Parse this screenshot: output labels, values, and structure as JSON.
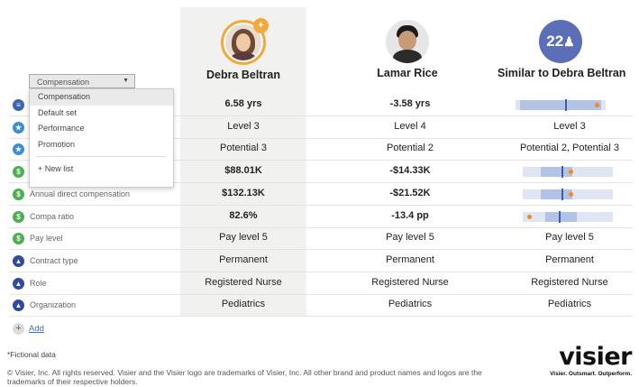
{
  "people": [
    {
      "name": "Debra Beltran",
      "avatar": "photo-woman",
      "pinned": true
    },
    {
      "name": "Lamar Rice",
      "avatar": "photo-man"
    },
    {
      "name": "Similar to Debra Beltran",
      "avatar_text": "22"
    }
  ],
  "dropdown": {
    "selected": "Compensation",
    "items": [
      "Compensation",
      "Default set",
      "Performance",
      "Promotion"
    ],
    "new_list_label": "New list"
  },
  "rows": [
    {
      "icon": "chart-icon",
      "label": "",
      "debra": "6.58 yrs",
      "lamar": "-3.58 yrs",
      "similar_bar": {
        "band": [
          0.05,
          0.95
        ],
        "tick": 0.55,
        "dot": 0.88
      }
    },
    {
      "icon": "star-icon",
      "label": "",
      "debra": "Level 3",
      "lamar": "Level 4",
      "similar": "Level 3"
    },
    {
      "icon": "star-icon",
      "label": "",
      "debra": "Potential 3",
      "lamar": "Potential 2",
      "similar": "Potential 2, Potential 3"
    },
    {
      "icon": "dollar-icon",
      "label": "",
      "debra": "$88.01K",
      "lamar": "-$14.33K",
      "similar_bar": {
        "band": [
          0.2,
          0.55
        ],
        "tick": 0.43,
        "dot": 0.51
      }
    },
    {
      "icon": "dollar-icon",
      "label": "Annual direct compensation",
      "debra": "$132.13K",
      "lamar": "-$21.52K",
      "similar_bar": {
        "band": [
          0.2,
          0.55
        ],
        "tick": 0.43,
        "dot": 0.51
      }
    },
    {
      "icon": "dollar-icon",
      "label": "Compa ratio",
      "debra": "82.6%",
      "lamar": "-13.4 pp",
      "similar_bar": {
        "band": [
          0.25,
          0.6
        ],
        "tick": 0.4,
        "dot": 0.05
      }
    },
    {
      "icon": "dollar-icon",
      "label": "Pay level",
      "debra": "Pay level 5",
      "lamar": "Pay level 5",
      "similar": "Pay level 5"
    },
    {
      "icon": "person-icon",
      "label": "Contract type",
      "debra": "Permanent",
      "lamar": "Permanent",
      "similar": "Permanent"
    },
    {
      "icon": "person-icon",
      "label": "Role",
      "debra": "Registered Nurse",
      "lamar": "Registered Nurse",
      "similar": "Registered Nurse"
    },
    {
      "icon": "person-icon",
      "label": "Organization",
      "debra": "Pediatrics",
      "lamar": "Pediatrics",
      "similar": "Pediatrics"
    }
  ],
  "add_label": "Add",
  "footnote": "*Fictional data",
  "legal": "© Visier, Inc. All rights reserved. Visier and the Visier logo are trademarks of Visier, Inc. All other brand and product names and logos are the trademarks of their respective holders.",
  "logo": {
    "word": "visier",
    "tagline": "Visier. Outsmart. Outperform."
  },
  "colors": {
    "accent": "#f2a93b",
    "bar_band": "#b3c3e6",
    "bar_tick": "#3b5cb0",
    "bar_dot": "#f08a1e",
    "link": "#3f6fc4"
  }
}
